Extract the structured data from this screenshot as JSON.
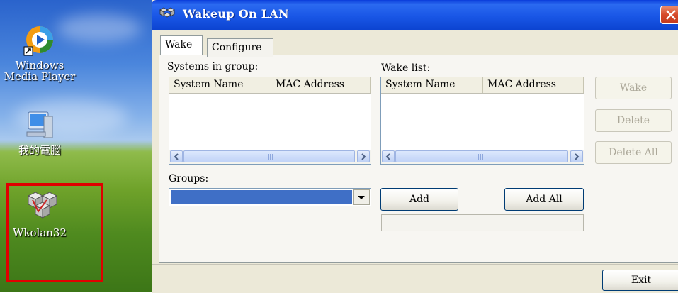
{
  "desktop": {
    "icons": [
      {
        "label": "Windows Media Player"
      },
      {
        "label": "我的電腦"
      },
      {
        "label": "Wkolan32"
      }
    ]
  },
  "window": {
    "title": "Wakeup On LAN",
    "tabs": [
      {
        "label": "Wake",
        "active": true
      },
      {
        "label": "Configure",
        "active": false
      }
    ],
    "systems_in_group": {
      "label": "Systems in group:",
      "columns": [
        "System Name",
        "MAC Address"
      ],
      "rows": []
    },
    "wake_list": {
      "label": "Wake list:",
      "columns": [
        "System Name",
        "MAC Address"
      ],
      "rows": []
    },
    "side_buttons": [
      {
        "label": "Wake",
        "enabled": false
      },
      {
        "label": "Delete",
        "enabled": false
      },
      {
        "label": "Delete All",
        "enabled": false
      }
    ],
    "groups": {
      "label": "Groups:",
      "selected": ""
    },
    "add_button": "Add",
    "add_all_button": "Add All",
    "exit_button": "Exit"
  },
  "colors": {
    "title_bar": "#1956e6",
    "close_button": "#d6492a",
    "highlight_box": "#e00000",
    "window_face": "#ece9d8",
    "combo_selection": "#3f6fc6"
  }
}
